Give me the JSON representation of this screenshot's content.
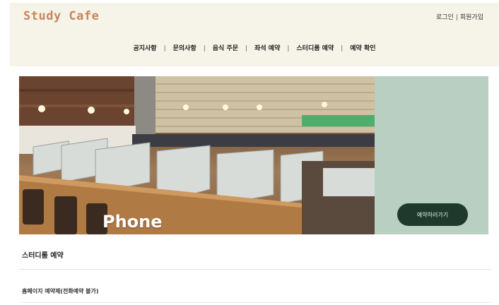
{
  "header": {
    "logo": "Study Cafe",
    "auth": {
      "login": "로그인",
      "separator": "|",
      "signup": "회원가입"
    },
    "nav": [
      {
        "label": "공지사항"
      },
      {
        "label": "문의사항"
      },
      {
        "label": "음식 주문"
      },
      {
        "label": "좌석 예약"
      },
      {
        "label": "스터디룸 예약"
      },
      {
        "label": "예약 확인"
      }
    ],
    "nav_separator": "|"
  },
  "hero": {
    "photo_label": "Phone",
    "reserve_button": "예약하러가기"
  },
  "section": {
    "title": "스터디룸 예약",
    "sub_link": "홈페이지 예약제(전화예약 불가)"
  },
  "colors": {
    "header_bg": "#f6f3e8",
    "logo": "#c9855c",
    "side_panel": "#b8cfc1",
    "button_bg": "#1f3a2c"
  }
}
